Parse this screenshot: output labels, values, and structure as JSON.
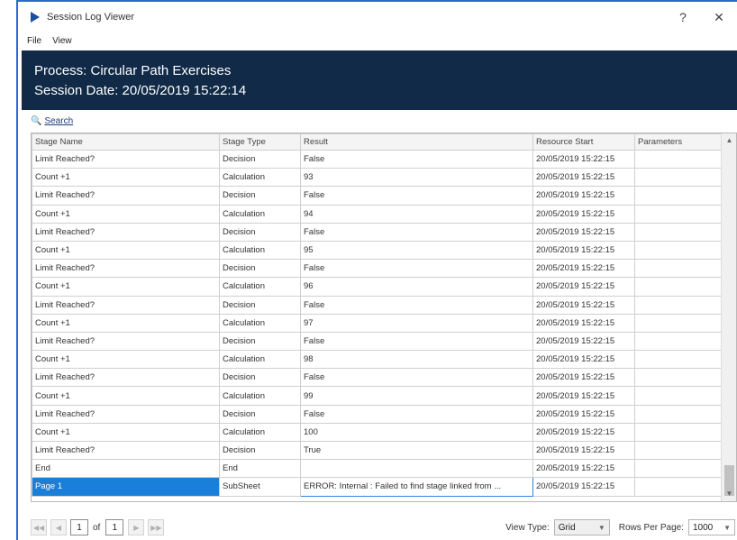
{
  "window": {
    "title": "Session Log Viewer",
    "help_label": "?",
    "close_label": "✕"
  },
  "menu": [
    "File",
    "View"
  ],
  "banner": {
    "process_line": "Process: Circular Path Exercises",
    "date_line": "Session Date: 20/05/2019 15:22:14"
  },
  "search": {
    "label": "Search"
  },
  "grid": {
    "columns": [
      "Stage Name",
      "Stage Type",
      "Result",
      "Resource Start",
      "Parameters"
    ],
    "rows": [
      [
        "Limit Reached?",
        "Decision",
        "False",
        "20/05/2019 15:22:15",
        ""
      ],
      [
        "Count +1",
        "Calculation",
        "93",
        "20/05/2019 15:22:15",
        ""
      ],
      [
        "Limit Reached?",
        "Decision",
        "False",
        "20/05/2019 15:22:15",
        ""
      ],
      [
        "Count +1",
        "Calculation",
        "94",
        "20/05/2019 15:22:15",
        ""
      ],
      [
        "Limit Reached?",
        "Decision",
        "False",
        "20/05/2019 15:22:15",
        ""
      ],
      [
        "Count +1",
        "Calculation",
        "95",
        "20/05/2019 15:22:15",
        ""
      ],
      [
        "Limit Reached?",
        "Decision",
        "False",
        "20/05/2019 15:22:15",
        ""
      ],
      [
        "Count +1",
        "Calculation",
        "96",
        "20/05/2019 15:22:15",
        ""
      ],
      [
        "Limit Reached?",
        "Decision",
        "False",
        "20/05/2019 15:22:15",
        ""
      ],
      [
        "Count +1",
        "Calculation",
        "97",
        "20/05/2019 15:22:15",
        ""
      ],
      [
        "Limit Reached?",
        "Decision",
        "False",
        "20/05/2019 15:22:15",
        ""
      ],
      [
        "Count +1",
        "Calculation",
        "98",
        "20/05/2019 15:22:15",
        ""
      ],
      [
        "Limit Reached?",
        "Decision",
        "False",
        "20/05/2019 15:22:15",
        ""
      ],
      [
        "Count +1",
        "Calculation",
        "99",
        "20/05/2019 15:22:15",
        ""
      ],
      [
        "Limit Reached?",
        "Decision",
        "False",
        "20/05/2019 15:22:15",
        ""
      ],
      [
        "Count +1",
        "Calculation",
        "100",
        "20/05/2019 15:22:15",
        ""
      ],
      [
        "Limit Reached?",
        "Decision",
        "True",
        "20/05/2019 15:22:15",
        ""
      ],
      [
        "End",
        "End",
        "",
        "20/05/2019 15:22:15",
        ""
      ],
      [
        "Page 1",
        "SubSheet",
        "ERROR: Internal : Failed to find stage linked from ...",
        "20/05/2019 15:22:15",
        ""
      ]
    ],
    "selected_row": 18
  },
  "footer": {
    "current_page": "1",
    "of_label": "of",
    "total_pages": "1",
    "view_type_label": "View Type:",
    "view_type_value": "Grid",
    "rows_per_page_label": "Rows Per Page:",
    "rows_per_page_value": "1000"
  },
  "colors": {
    "banner_bg": "#102a47",
    "selection": "#1a7fd8",
    "window_border": "#2a6bd1"
  }
}
